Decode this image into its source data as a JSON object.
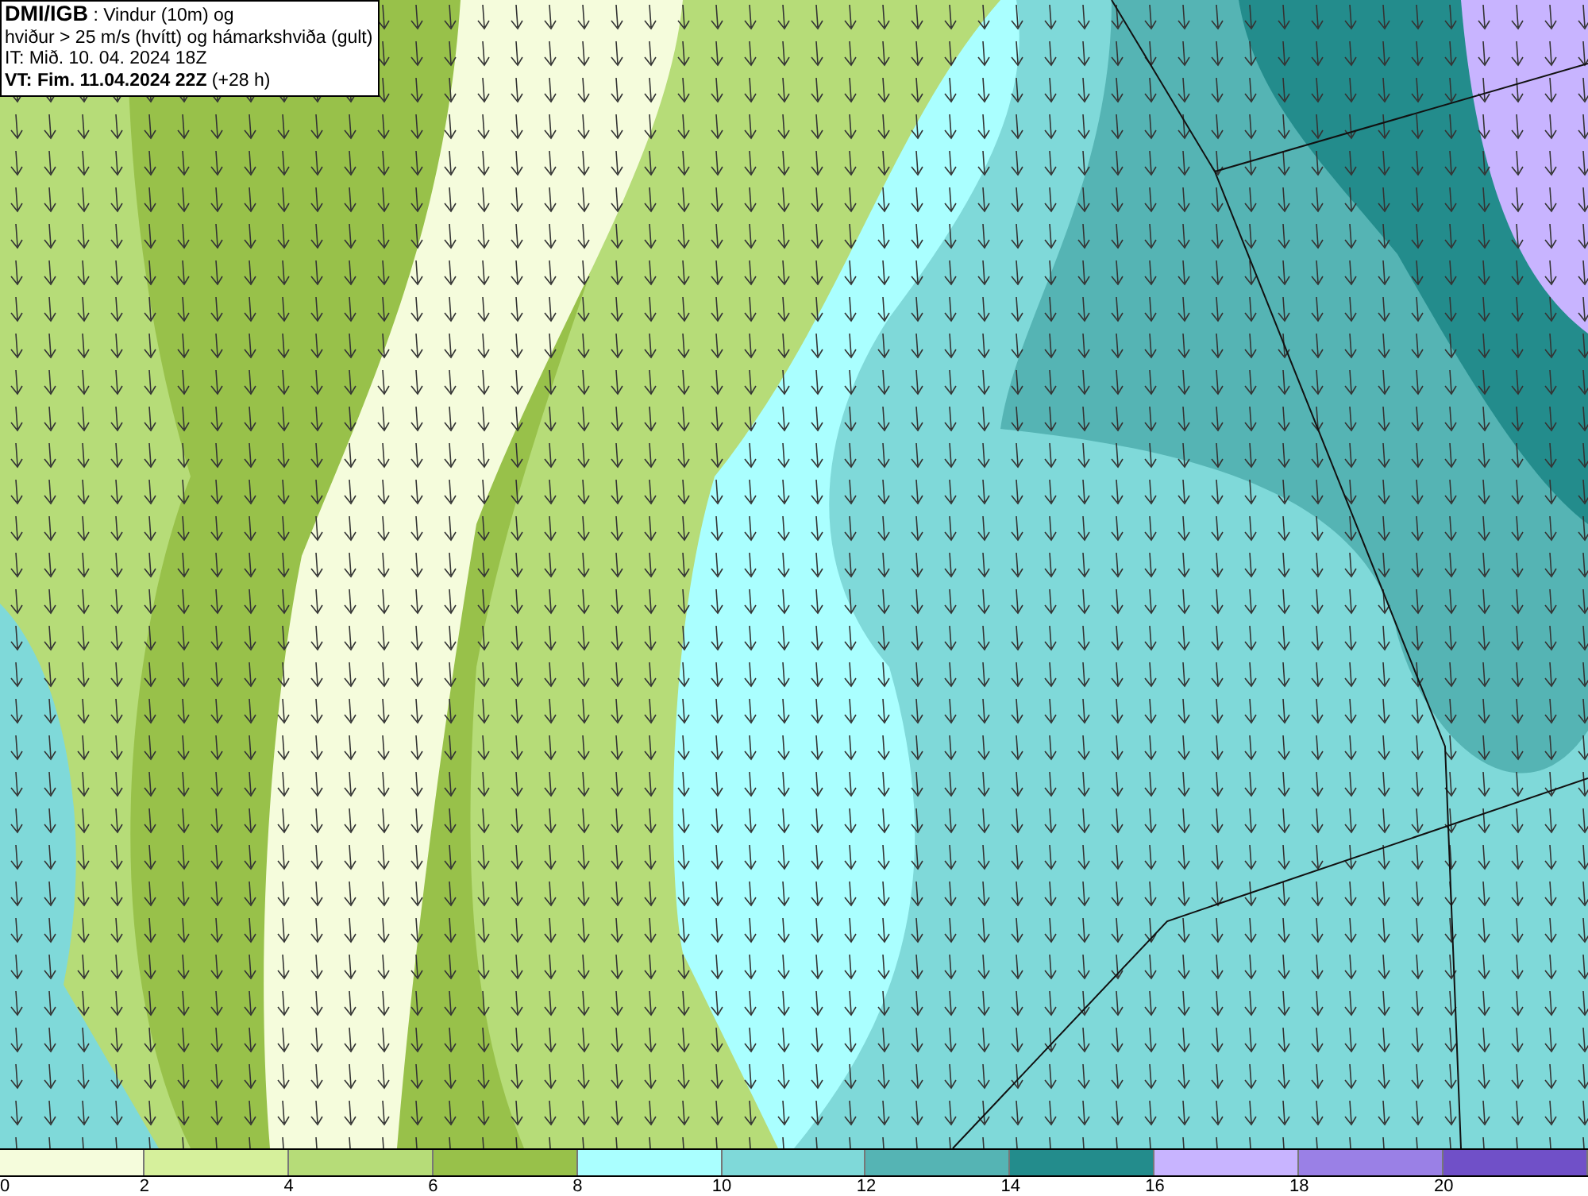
{
  "info_box": {
    "lines": [
      "**DMI/IGB** : Vindur (10m) og",
      "hviður > 25 m/s (hvítt) og hámarkshviða (gult)",
      "IT: Mið. 10. 04. 2024 18Z",
      "**VT: Fim. 11.04.2024 22Z** (+28 h)"
    ]
  },
  "legend": {
    "swatches": [
      {
        "color": "#f5fcdc"
      },
      {
        "color": "#d6f09c"
      },
      {
        "color": "#b6dc78"
      },
      {
        "color": "#98c14a"
      },
      {
        "color": "#aaffff"
      },
      {
        "color": "#7fd9d9"
      },
      {
        "color": "#55b4b4"
      },
      {
        "color": "#238c8c"
      },
      {
        "color": "#c8b4ff"
      },
      {
        "color": "#9a80e6"
      },
      {
        "color": "#7050c8"
      }
    ],
    "ticks": [
      "0",
      "2",
      "4",
      "6",
      "8",
      "10",
      "12",
      "14",
      "16",
      "18",
      "20"
    ]
  }
}
